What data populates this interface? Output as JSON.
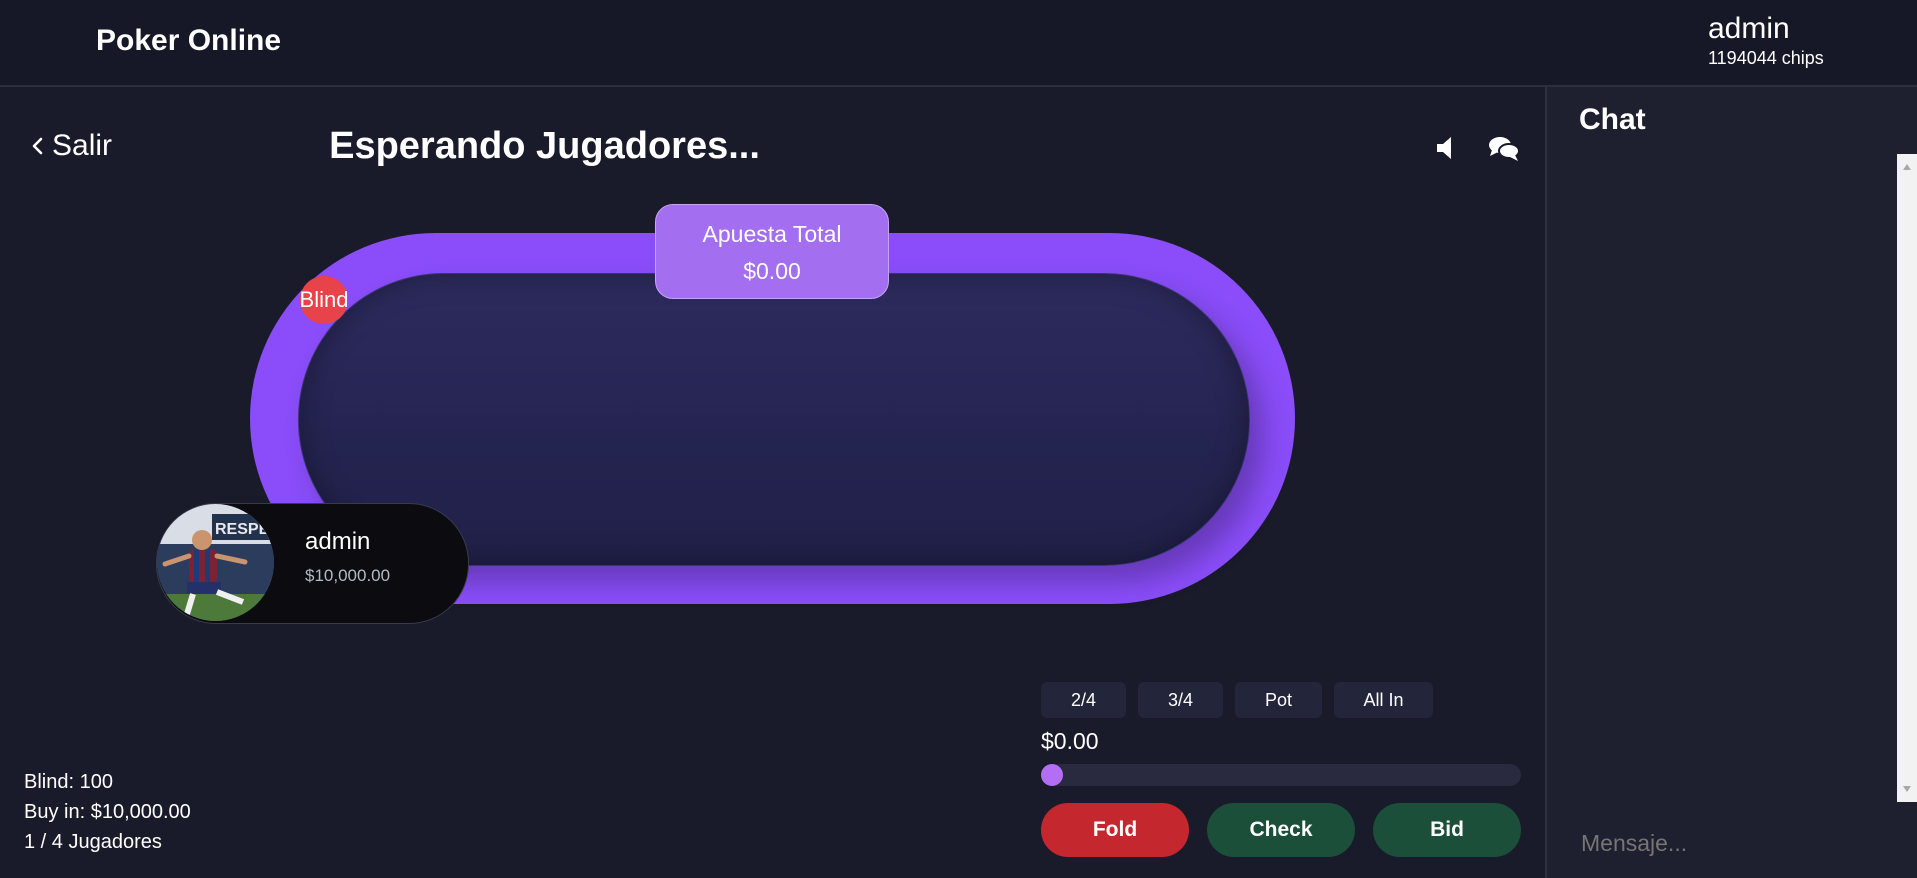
{
  "app": {
    "title": "Poker Online"
  },
  "user": {
    "name": "admin",
    "chips": "1194044 chips"
  },
  "game": {
    "back_label": "Salir",
    "status": "Esperando Jugadores...",
    "pot": {
      "label": "Apuesta Total",
      "amount": "$0.00"
    },
    "blind_marker": "Blind",
    "seat": {
      "name": "admin",
      "stack": "$10,000.00"
    },
    "info": {
      "blind": "Blind: 100",
      "buy_in": "Buy in: $10,000.00",
      "players": "1 / 4 Jugadores"
    },
    "quick_bets": [
      "2/4",
      "3/4",
      "Pot",
      "All In"
    ],
    "bet_amount": "$0.00",
    "bet_slider_fraction": 0,
    "actions": {
      "fold": "Fold",
      "check": "Check",
      "bid": "Bid"
    }
  },
  "chat": {
    "title": "Chat",
    "placeholder": "Mensaje..."
  },
  "colors": {
    "rail": "#8a4df9",
    "pot": "#a36ef0",
    "blind": "#e8434b",
    "fold": "#c4272e",
    "check": "#1b4f3a",
    "bid": "#1b4f3a",
    "slider_thumb": "#b46ef4"
  },
  "icons": {
    "back": "chevron-left-icon",
    "sound": "speaker-icon",
    "chat": "chat-bubbles-icon"
  }
}
